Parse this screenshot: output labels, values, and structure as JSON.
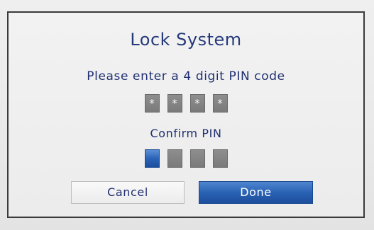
{
  "dialog": {
    "title": "Lock System",
    "prompt": "Please enter a 4 digit PIN code",
    "pin_entry": {
      "digits": [
        "*",
        "*",
        "*",
        "*"
      ]
    },
    "confirm_label": "Confirm PIN",
    "confirm_entry": {
      "digits": [
        "",
        "",
        "",
        ""
      ],
      "active_index": 0
    },
    "buttons": {
      "cancel_label": "Cancel",
      "done_label": "Done"
    }
  },
  "colors": {
    "accent_blue": "#2a62b4",
    "title_text": "#263a7a",
    "pin_box_gray": "#7a7a7a"
  }
}
